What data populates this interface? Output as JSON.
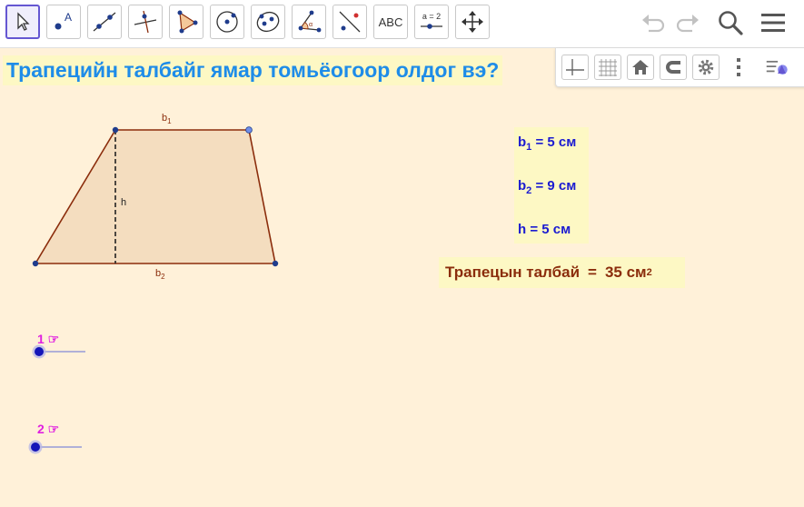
{
  "toolbar": {
    "tools": [
      {
        "name": "move-tool",
        "icon": "cursor-arrow-icon",
        "active": true
      },
      {
        "name": "point-tool",
        "icon": "point-a-icon"
      },
      {
        "name": "line-tool",
        "icon": "line-through-points-icon"
      },
      {
        "name": "perpendicular-tool",
        "icon": "perpendicular-line-icon"
      },
      {
        "name": "polygon-tool",
        "icon": "polygon-icon"
      },
      {
        "name": "circle-tool",
        "icon": "circle-center-point-icon"
      },
      {
        "name": "ellipse-tool",
        "icon": "ellipse-icon"
      },
      {
        "name": "angle-tool",
        "icon": "angle-icon"
      },
      {
        "name": "reflect-tool",
        "icon": "reflect-about-line-icon"
      },
      {
        "name": "text-tool",
        "icon": "text-abc-icon",
        "label": "ABC"
      },
      {
        "name": "slider-tool",
        "icon": "slider-icon",
        "label": "a = 2"
      },
      {
        "name": "move-graphics-tool",
        "icon": "move-arrows-icon"
      }
    ],
    "right_icons": [
      "undo-icon",
      "redo-icon",
      "search-icon",
      "menu-icon"
    ]
  },
  "question": "Трапецийн талбайг ямар томьёогоор олдог вэ?",
  "style_bar": {
    "buttons": [
      "axes-icon",
      "grid-icon",
      "home-icon",
      "magnet-icon",
      "settings-icon",
      "more-vertical-icon"
    ],
    "toggle_icon": "style-bar-toggle-icon"
  },
  "figure": {
    "label_b1": "b",
    "label_b1_sub": "1",
    "label_b2": "b",
    "label_b2_sub": "2",
    "label_h": "h",
    "fill_color": "#f4ddbf",
    "stroke_color": "#8b2d0c",
    "point_color": "#1f3c8c"
  },
  "variables": [
    {
      "name": "b",
      "sub": "1",
      "value": " = 5  см"
    },
    {
      "name": "b",
      "sub": "2",
      "value": "  = 9 см"
    },
    {
      "name": "h",
      "sub": "",
      "value": "  = 5 см"
    }
  ],
  "area": {
    "label": "Трапецын талбай",
    "equals": "=",
    "value": "35 см",
    "exponent": "2"
  },
  "sliders": [
    {
      "label": "1 ☞",
      "value": 0
    },
    {
      "label": "2 ☞",
      "value": 0
    }
  ],
  "colors": {
    "accent": "#6557d2",
    "question_text": "#1e8ce8",
    "canvas_bg": "#fff1d9",
    "label_bg": "#fdf8c4",
    "variable_text": "#1b1bd1",
    "area_text": "#8b2d0c",
    "slider_label": "#e020e0",
    "slider_point": "#1515b8"
  }
}
